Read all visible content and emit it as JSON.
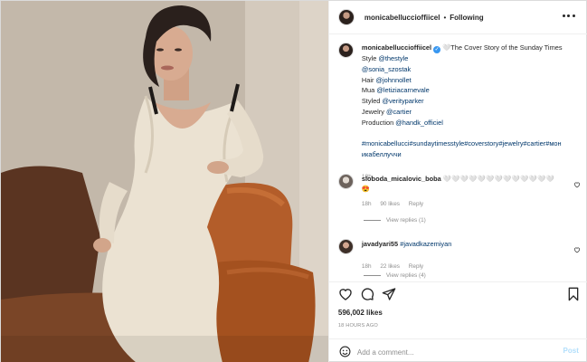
{
  "post": {
    "image_alt": "Photo of woman in cream knit dress on leather sofa"
  },
  "header": {
    "username": "monicabelluccioffiicel",
    "separator": "•",
    "follow_status": "Following"
  },
  "caption": {
    "username": "monicabelluccioffiicel",
    "text_start": "🤍The Cover Story of the Sunday Times",
    "lines": [
      {
        "prefix": "Style ",
        "tag": "@thestyle"
      },
      {
        "prefix": "",
        "tag": "@sonia_szostak"
      },
      {
        "prefix": "Hair ",
        "tag": "@johnnollet"
      },
      {
        "prefix": "Mua ",
        "tag": "@letiziacarnevale"
      },
      {
        "prefix": "Styled ",
        "tag": "@verityparker"
      },
      {
        "prefix": "Jewelry ",
        "tag": "@cartier"
      },
      {
        "prefix": "Production ",
        "tag": "@handk_officiel"
      }
    ],
    "hashtags": "#monicabellucci#sundaytimesstyle#coverstory#jewelry#cartier#мон",
    "hashtags_cont": "икабеллуччи",
    "time": "18h"
  },
  "comments": [
    {
      "username": "sloboda_micalovic_boba",
      "text": "🤍🤍🤍🤍🤍🤍🤍🤍🤍🤍🤍🤍🤍",
      "text2": "😍",
      "time": "18h",
      "likes": "90 likes",
      "reply": "Reply",
      "view_replies": "View replies (1)"
    },
    {
      "username": "javadyari55",
      "text": "#javadkazemiyan",
      "time": "18h",
      "likes": "22 likes",
      "reply": "Reply",
      "view_replies": "View replies (4)"
    }
  ],
  "actions": {
    "likes": "596,002 likes",
    "posted": "18 HOURS AGO"
  },
  "add_comment": {
    "placeholder": "Add a comment...",
    "post_label": "Post"
  },
  "colors": {
    "link": "#00376b",
    "verified": "#3897f0",
    "muted": "#8e8e8e",
    "post_button": "#b2dffc"
  }
}
